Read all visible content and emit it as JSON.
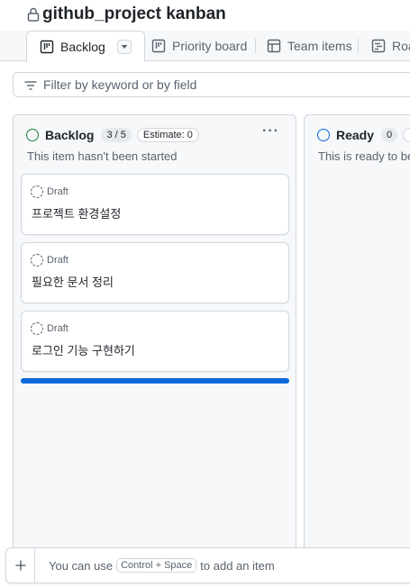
{
  "project": {
    "title": "github_project kanban",
    "lock_icon": "lock-icon"
  },
  "tabs": [
    {
      "label": "Backlog",
      "icon": "board-icon",
      "active": true
    },
    {
      "label": "Priority board",
      "icon": "board-icon"
    },
    {
      "label": "Team items",
      "icon": "table-icon"
    },
    {
      "label": "Roa",
      "icon": "roadmap-icon"
    }
  ],
  "filter": {
    "placeholder": "Filter by keyword or by field"
  },
  "columns": [
    {
      "name": "Backlog",
      "count": "3 / 5",
      "estimate": "Estimate: 0",
      "description": "This item hasn't been started",
      "status_color": "#1a7f37",
      "cards": [
        {
          "type": "Draft",
          "title": "프로젝트 환경설정"
        },
        {
          "type": "Draft",
          "title": "필요한 문서 정리"
        },
        {
          "type": "Draft",
          "title": "로그인 기능 구현하기"
        }
      ]
    },
    {
      "name": "Ready",
      "count": "0",
      "estimate": "E",
      "description": "This is ready to be",
      "status_color": "#0969da"
    }
  ],
  "footer": {
    "prefix": "You can use",
    "shortcut": "Control + Space",
    "suffix": "to add an item"
  },
  "colors": {
    "accent": "#0969da",
    "border": "#d0d7de",
    "muted": "#59636e"
  }
}
